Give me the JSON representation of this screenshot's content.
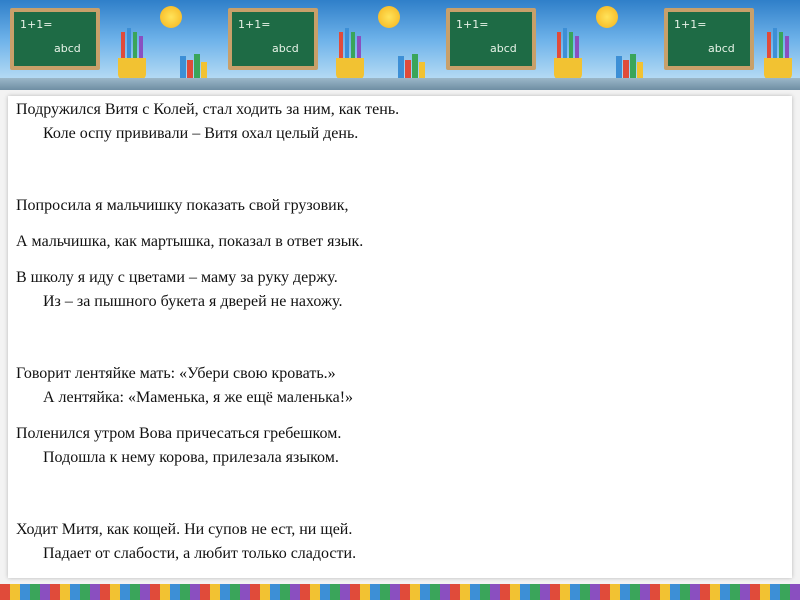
{
  "colors": {
    "sky_top": "#2f7fc9",
    "chalkboard": "#1e6b45",
    "frame": "#f3f3f3",
    "text": "#111111"
  },
  "banner": {
    "board_marks": [
      "1+1=",
      "abcd"
    ],
    "icons": [
      "chalkboard-icon",
      "sun-icon",
      "pencil-cup-icon",
      "books-icon"
    ]
  },
  "poems": [
    {
      "lines": [
        "Подружился Витя с Колей, стал ходить за ним, как тень.",
        "Коле оспу прививали – Витя охал целый день."
      ]
    },
    {
      "lines": [
        "Попросила я мальчишку показать свой грузовик,"
      ]
    },
    {
      "lines": [
        "А мальчишка, как мартышка, показал в ответ язык."
      ]
    },
    {
      "lines": [
        "В школу я иду с цветами – маму за руку держу.",
        "Из – за пышного букета я дверей не нахожу."
      ]
    },
    {
      "lines": [
        "Говорит лентяйке мать: «Убери свою кровать.»",
        "А лентяйка: «Маменька, я же ещё маленька!»"
      ]
    },
    {
      "lines": [
        "Поленился утром Вова причесаться гребешком.",
        "Подошла к нему корова, прилезала языком."
      ]
    },
    {
      "lines": [
        "Ходит Митя, как кощей. Ни супов не ест, ни щей.",
        "Падает от слабости, а любит только сладости."
      ]
    }
  ]
}
